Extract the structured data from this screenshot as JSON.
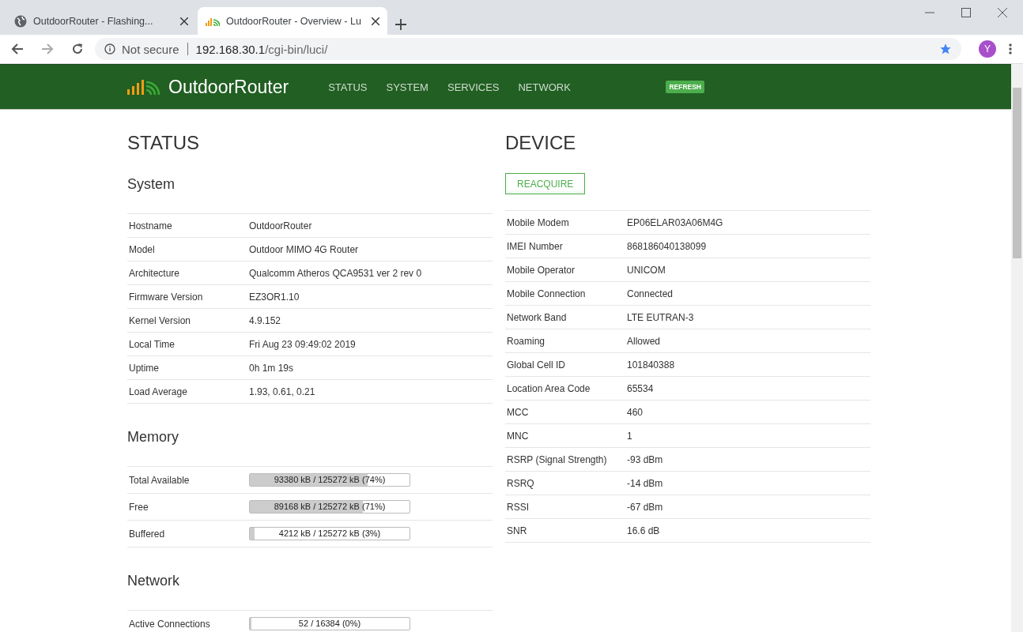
{
  "browser": {
    "tabs": [
      {
        "title": "OutdoorRouter - Flashing...",
        "selected": false,
        "kind": "globe"
      },
      {
        "title": "OutdoorRouter - Overview - Lu",
        "selected": true,
        "kind": "logo"
      }
    ],
    "security": "Not secure",
    "url_host": "192.168.30.1",
    "url_path": "/cgi-bin/luci/",
    "profile": "Y"
  },
  "header": {
    "brand": "OutdoorRouter",
    "nav": [
      "STATUS",
      "SYSTEM",
      "SERVICES",
      "NETWORK"
    ],
    "refresh": "REFRESH"
  },
  "status": {
    "title": "STATUS",
    "system": {
      "title": "System",
      "rows": [
        {
          "label": "Hostname",
          "value": "OutdoorRouter"
        },
        {
          "label": "Model",
          "value": "Outdoor MIMO 4G Router"
        },
        {
          "label": "Architecture",
          "value": "Qualcomm Atheros QCA9531 ver 2 rev 0"
        },
        {
          "label": "Firmware Version",
          "value": "EZ3OR1.10"
        },
        {
          "label": "Kernel Version",
          "value": "4.9.152"
        },
        {
          "label": "Local Time",
          "value": "Fri Aug 23 09:49:02 2019"
        },
        {
          "label": "Uptime",
          "value": "0h 1m 19s"
        },
        {
          "label": "Load Average",
          "value": "1.93, 0.61, 0.21"
        }
      ]
    },
    "memory": {
      "title": "Memory",
      "rows": [
        {
          "label": "Total Available",
          "reading": "93380 kB / 125272 kB (74%)",
          "level": 0.74
        },
        {
          "label": "Free",
          "reading": "89168 kB / 125272 kB (71%)",
          "level": 0.71
        },
        {
          "label": "Buffered",
          "reading": "4212 kB / 125272 kB (3%)",
          "level": 0.03
        }
      ]
    },
    "network": {
      "title": "Network",
      "rows": [
        {
          "label": "Active Connections",
          "reading": "52 / 16384 (0%)",
          "level": 0.0
        }
      ]
    }
  },
  "device": {
    "title": "DEVICE",
    "button": "REACQUIRE",
    "rows": [
      {
        "label": "Mobile Modem",
        "value": "EP06ELAR03A06M4G"
      },
      {
        "label": "IMEI Number",
        "value": "868186040138099"
      },
      {
        "label": "Mobile Operator",
        "value": "UNICOM"
      },
      {
        "label": "Mobile Connection",
        "value": "Connected"
      },
      {
        "label": "Network Band",
        "value": "LTE EUTRAN-3"
      },
      {
        "label": "Roaming",
        "value": "Allowed"
      },
      {
        "label": "Global Cell ID",
        "value": "101840388"
      },
      {
        "label": "Location Area Code",
        "value": "65534"
      },
      {
        "label": "MCC",
        "value": "460"
      },
      {
        "label": "MNC",
        "value": "1"
      },
      {
        "label": "RSRP (Signal Strength)",
        "value": "-93 dBm"
      },
      {
        "label": "RSRQ",
        "value": "-14 dBm"
      },
      {
        "label": "RSSI",
        "value": "-67 dBm"
      },
      {
        "label": "SNR",
        "value": "16.6 dB"
      }
    ]
  }
}
